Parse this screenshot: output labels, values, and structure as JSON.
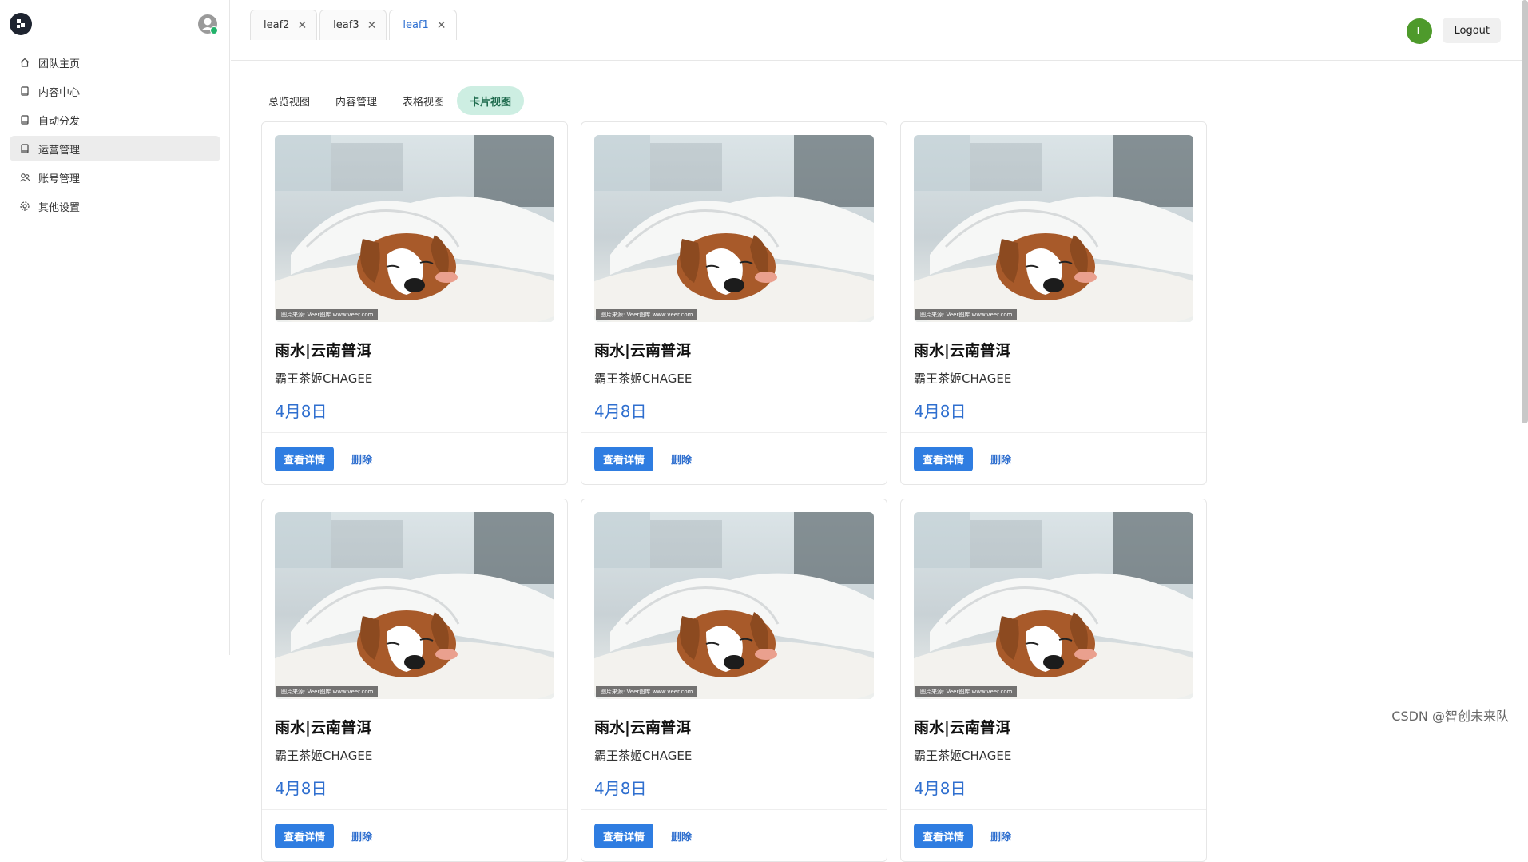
{
  "sidebar": {
    "items": [
      {
        "label": "团队主页",
        "icon": "home-icon"
      },
      {
        "label": "内容中心",
        "icon": "document-icon"
      },
      {
        "label": "自动分发",
        "icon": "document-icon"
      },
      {
        "label": "运营管理",
        "icon": "document-icon",
        "active": true
      },
      {
        "label": "账号管理",
        "icon": "users-icon"
      },
      {
        "label": "其他设置",
        "icon": "gear-icon"
      }
    ]
  },
  "topbar": {
    "open_tabs": [
      {
        "label": "leaf2"
      },
      {
        "label": "leaf3"
      },
      {
        "label": "leaf1",
        "active": true
      }
    ],
    "user_initial": "L",
    "logout_label": "Logout"
  },
  "view_tabs": [
    {
      "label": "总览视图"
    },
    {
      "label": "内容管理"
    },
    {
      "label": "表格视图"
    },
    {
      "label": "卡片视图",
      "active": true
    }
  ],
  "cards": [
    {
      "title": "雨水|云南普洱",
      "subtitle": "霸王茶姬CHAGEE",
      "date": "4月8日",
      "detail_label": "查看详情",
      "delete_label": "删除",
      "image_credit": "图片来源: Veer图库 www.veer.com"
    },
    {
      "title": "雨水|云南普洱",
      "subtitle": "霸王茶姬CHAGEE",
      "date": "4月8日",
      "detail_label": "查看详情",
      "delete_label": "删除",
      "image_credit": "图片来源: Veer图库 www.veer.com"
    },
    {
      "title": "雨水|云南普洱",
      "subtitle": "霸王茶姬CHAGEE",
      "date": "4月8日",
      "detail_label": "查看详情",
      "delete_label": "删除",
      "image_credit": "图片来源: Veer图库 www.veer.com"
    },
    {
      "title": "雨水|云南普洱",
      "subtitle": "霸王茶姬CHAGEE",
      "date": "4月8日",
      "detail_label": "查看详情",
      "delete_label": "删除",
      "image_credit": "图片来源: Veer图库 www.veer.com"
    },
    {
      "title": "雨水|云南普洱",
      "subtitle": "霸王茶姬CHAGEE",
      "date": "4月8日",
      "detail_label": "查看详情",
      "delete_label": "删除",
      "image_credit": "图片来源: Veer图库 www.veer.com"
    },
    {
      "title": "雨水|云南普洱",
      "subtitle": "霸王茶姬CHAGEE",
      "date": "4月8日",
      "detail_label": "查看详情",
      "delete_label": "删除",
      "image_credit": "图片来源: Veer图库 www.veer.com"
    }
  ],
  "watermark": "CSDN @智创未来队",
  "colors": {
    "accent": "#2f7de1",
    "link": "#2f6fcf",
    "active_tab_bg": "#cdeee2",
    "user_avatar": "#4e9a2b"
  }
}
